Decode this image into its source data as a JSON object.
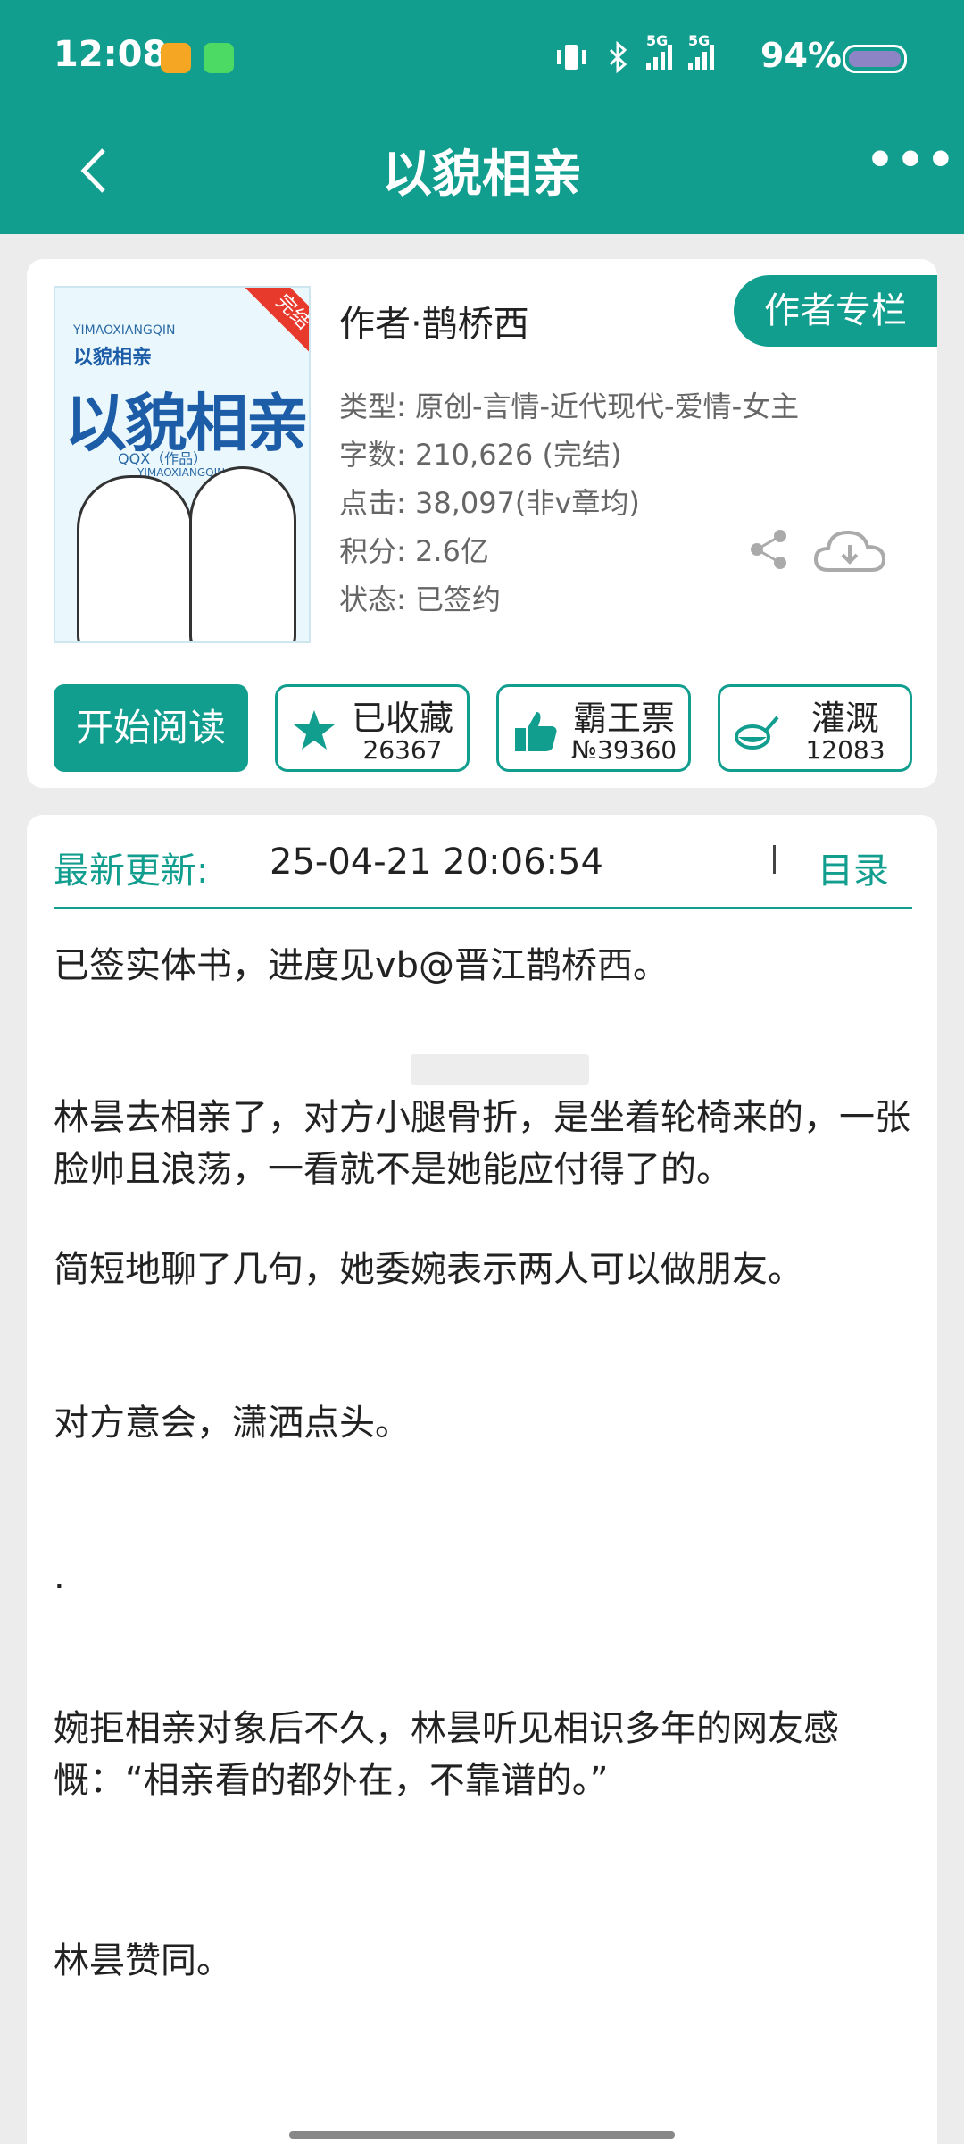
{
  "status": {
    "time": "12:08",
    "battery": "94%",
    "network_1": "5G",
    "network_2": "5G"
  },
  "header": {
    "title": "以貌相亲",
    "back_icon": "chevron-left-icon",
    "more_label": "•••"
  },
  "book": {
    "cover_badge": "完结",
    "cover_pinyin_top": "YIMAOXIANGQIN",
    "cover_title_small": "以貌相亲",
    "cover_title_big": "以貌相亲",
    "cover_author": "QQX（作品）",
    "cover_pinyin_bottom": "YIMAOXIANGQIN",
    "author": "作者·鹊桥西",
    "author_button": "作者专栏",
    "type": "类型: 原创-言情-近代现代-爱情-女主",
    "words": "字数: 210,626 (完结)",
    "clicks": "点击: 38,097(非v章均)",
    "points": "积分: 2.6亿",
    "status": "状态: 已签约",
    "accent_color": "#129e8e"
  },
  "actions": {
    "read": "开始阅读",
    "favorite": {
      "label": "已收藏",
      "count": "26367",
      "icon": "star-icon"
    },
    "ticket": {
      "label": "霸王票",
      "count": "№39360",
      "icon": "thumbs-up-icon"
    },
    "water": {
      "label": "灌溉",
      "count": "12083",
      "icon": "watering-icon"
    }
  },
  "content": {
    "update_label": "最新更新:",
    "update_time": "25-04-21 20:06:54",
    "toc": "目录",
    "paragraphs": [
      "已签实体书，进度见vb@晋江鹊桥西。",
      "林昙去相亲了，对方小腿骨折，是坐着轮椅来的，一张脸帅且浪荡，一看就不是她能应付得了的。",
      "简短地聊了几句，她委婉表示两人可以做朋友。",
      "对方意会，潇洒点头。",
      ".",
      "婉拒相亲对象后不久，林昙听见相识多年的网友感慨：“相亲看的都外在，不靠谱的。”",
      "林昙赞同。"
    ]
  }
}
